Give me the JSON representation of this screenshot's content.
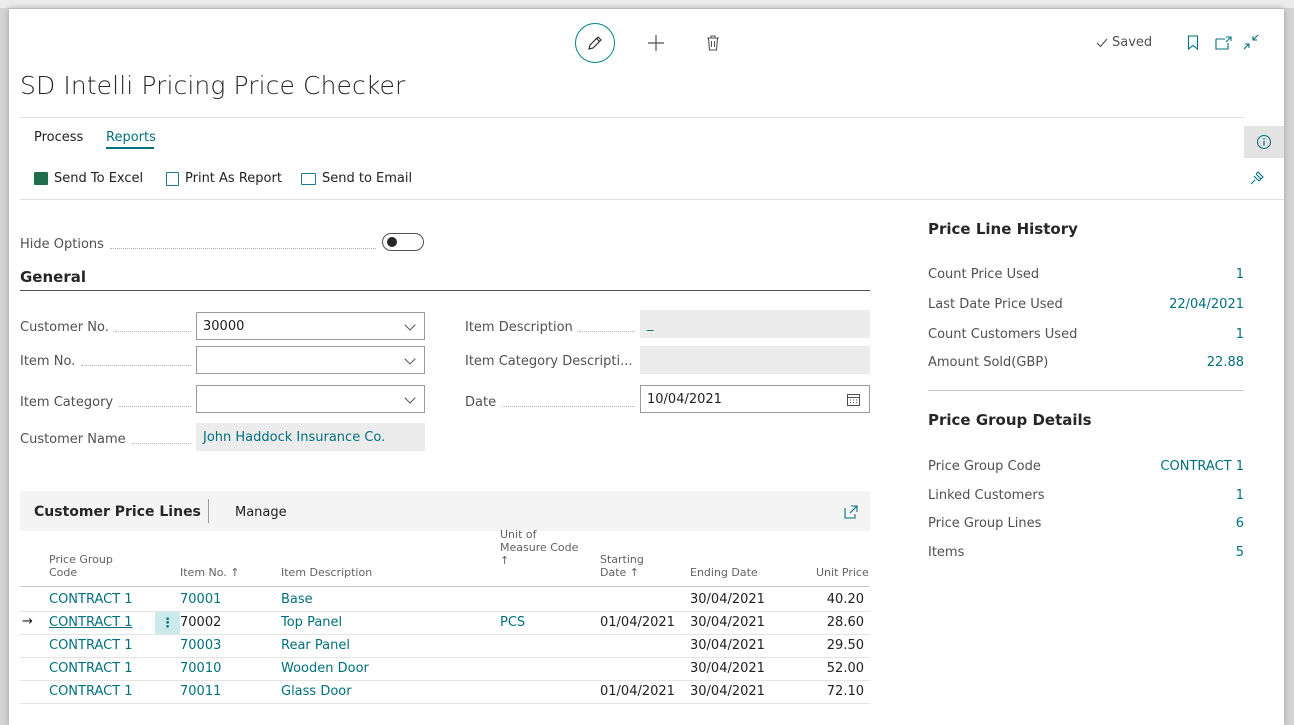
{
  "toolbar": {
    "saved_label": "Saved"
  },
  "page_title": "SD Intelli Pricing Price Checker",
  "menu": {
    "process": "Process",
    "reports": "Reports"
  },
  "actions": {
    "send_to_excel": "Send To Excel",
    "print_as_report": "Print As Report",
    "send_to_email": "Send to Email"
  },
  "options": {
    "hide_options_label": "Hide Options",
    "hide_options_value": false
  },
  "general": {
    "title": "General",
    "customer_no_label": "Customer No.",
    "customer_no_value": "30000",
    "item_no_label": "Item No.",
    "item_no_value": "",
    "item_category_label": "Item Category",
    "item_category_value": "",
    "customer_name_label": "Customer Name",
    "customer_name_value": "John Haddock Insurance Co.",
    "item_description_label": "Item Description",
    "item_description_value": "_",
    "item_category_description_label": "Item Category Descripti...",
    "item_category_description_value": "",
    "date_label": "Date",
    "date_value": "10/04/2021"
  },
  "price_lines": {
    "title": "Customer Price Lines",
    "manage_label": "Manage",
    "columns": {
      "price_group_code_1": "Price Group",
      "price_group_code_2": "Code",
      "item_no": "Item No. ↑",
      "item_description": "Item Description",
      "uom_1": "Unit of",
      "uom_2": "Measure Code",
      "uom_3": "↑",
      "starting_1": "Starting",
      "starting_2": "Date ↑",
      "ending_date": "Ending Date",
      "unit_price": "Unit Price"
    },
    "rows": [
      {
        "code": "CONTRACT 1",
        "item_no": "70001",
        "description": "Base",
        "uom": "",
        "starting": "",
        "ending": "30/04/2021",
        "price": "40.20"
      },
      {
        "code": "CONTRACT 1",
        "item_no": "70002",
        "description": "Top Panel",
        "uom": "PCS",
        "starting": "01/04/2021",
        "ending": "30/04/2021",
        "price": "28.60"
      },
      {
        "code": "CONTRACT 1",
        "item_no": "70003",
        "description": "Rear Panel",
        "uom": "",
        "starting": "",
        "ending": "30/04/2021",
        "price": "29.50"
      },
      {
        "code": "CONTRACT 1",
        "item_no": "70010",
        "description": "Wooden Door",
        "uom": "",
        "starting": "",
        "ending": "30/04/2021",
        "price": "52.00"
      },
      {
        "code": "CONTRACT 1",
        "item_no": "70011",
        "description": "Glass Door",
        "uom": "",
        "starting": "01/04/2021",
        "ending": "30/04/2021",
        "price": "72.10"
      }
    ]
  },
  "factbox": {
    "history_title": "Price Line History",
    "count_price_used_label": "Count Price Used",
    "count_price_used_value": "1",
    "last_date_price_used_label": "Last Date Price Used",
    "last_date_price_used_value": "22/04/2021",
    "count_customers_used_label": "Count Customers Used",
    "count_customers_used_value": "1",
    "amount_sold_label": "Amount Sold(GBP)",
    "amount_sold_value": "22.88",
    "group_title": "Price Group Details",
    "price_group_code_label": "Price Group Code",
    "price_group_code_value": "CONTRACT 1",
    "linked_customers_label": "Linked Customers",
    "linked_customers_value": "1",
    "price_group_lines_label": "Price Group Lines",
    "price_group_lines_value": "6",
    "items_label": "Items",
    "items_value": "5"
  },
  "colors": {
    "accent": "#00707d",
    "link": "#00707d"
  }
}
